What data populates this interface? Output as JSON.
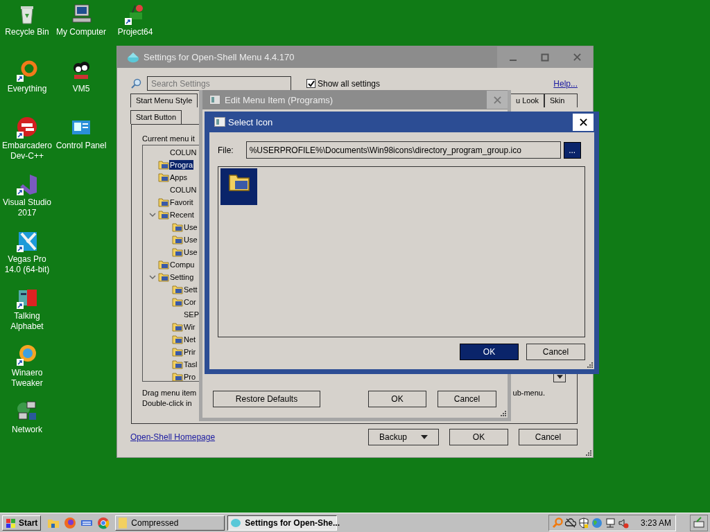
{
  "desktop_icons": [
    {
      "label": "Recycle Bin",
      "shortcut": false
    },
    {
      "label": "My Computer",
      "shortcut": false
    },
    {
      "label": "Project64",
      "shortcut": true
    },
    {
      "label": "Everything",
      "shortcut": true
    },
    {
      "label": "VM5",
      "shortcut": false
    },
    {
      "label": "Embarcadero Dev-C++",
      "shortcut": true
    },
    {
      "label": "Control Panel",
      "shortcut": false
    },
    {
      "label": "Visual Studio 2017",
      "shortcut": true
    },
    {
      "label": "Vegas Pro 14.0 (64-bit)",
      "shortcut": true
    },
    {
      "label": "Talking Alphabet",
      "shortcut": true
    },
    {
      "label": "Winaero Tweaker",
      "shortcut": true
    },
    {
      "label": "Network",
      "shortcut": false
    }
  ],
  "settings_window": {
    "title": "Settings for Open-Shell Menu 4.4.170",
    "search": {
      "placeholder": "Search Settings"
    },
    "show_all": {
      "label": "Show all settings",
      "checked": true
    },
    "help_link": "Help...",
    "tabs_row_1": [
      {
        "label": "Start Menu Style",
        "selected": false
      },
      {
        "label": "u Look",
        "selected": false
      },
      {
        "label": "Skin",
        "selected": false
      }
    ],
    "tabs_row_2": [
      {
        "label": "Start Button",
        "selected": false
      }
    ],
    "tree_label": "Current menu it",
    "tree": [
      {
        "label": "COLUN",
        "kind": "break",
        "selected": false
      },
      {
        "label": "Progra",
        "kind": "item",
        "selected": true
      },
      {
        "label": "Apps",
        "kind": "item",
        "selected": false
      },
      {
        "label": "COLUN",
        "kind": "break",
        "selected": false
      },
      {
        "label": "Favorit",
        "kind": "item",
        "selected": false
      },
      {
        "label": "Recent",
        "kind": "item",
        "selected": false,
        "expanded": true,
        "children": [
          {
            "label": "Use",
            "kind": "item",
            "selected": false
          },
          {
            "label": "Use",
            "kind": "item",
            "selected": false
          },
          {
            "label": "Use",
            "kind": "item",
            "selected": false
          }
        ]
      },
      {
        "label": "Compu",
        "kind": "item",
        "selected": false
      },
      {
        "label": "Setting",
        "kind": "item",
        "selected": false,
        "expanded": true,
        "children": [
          {
            "label": "Sett",
            "kind": "item",
            "selected": false
          },
          {
            "label": "Cor",
            "kind": "item",
            "selected": false
          },
          {
            "label": "SEP",
            "kind": "break",
            "selected": false
          },
          {
            "label": "Wir",
            "kind": "item",
            "selected": false
          },
          {
            "label": "Net",
            "kind": "item",
            "selected": false
          },
          {
            "label": "Prir",
            "kind": "item",
            "selected": false
          },
          {
            "label": "Tasl",
            "kind": "item",
            "selected": false
          },
          {
            "label": "Pro",
            "kind": "item",
            "selected": false
          }
        ]
      }
    ],
    "hint_lines": [
      "Drag menu item",
      "Double-click in"
    ],
    "hint_tail": "ub-menu.",
    "homepage_link": "Open-Shell Homepage",
    "buttons": [
      {
        "label": "Backup",
        "kind": "split"
      },
      {
        "label": "OK",
        "kind": "plain"
      },
      {
        "label": "Cancel",
        "kind": "plain"
      }
    ]
  },
  "edit_dialog": {
    "title": "Edit Menu Item (Programs)",
    "buttons": [
      "Restore Defaults",
      "OK",
      "Cancel"
    ]
  },
  "select_icon_dialog": {
    "title": "Select Icon",
    "file_label": "File:",
    "file_value": "%USERPROFILE%\\Documents\\Win98icons\\directory_program_group.ico",
    "browse_button": {
      "label": "...",
      "focused": true
    },
    "icons": [
      {
        "selected": true
      }
    ],
    "buttons": [
      {
        "label": "OK",
        "focused": true
      },
      {
        "label": "Cancel",
        "focused": false
      }
    ]
  },
  "taskbar": {
    "start": "Start",
    "tasks": [
      {
        "label": "Compressed",
        "selected": false
      },
      {
        "label": "Settings for Open-She...",
        "selected": true
      }
    ],
    "clock": "3:23 AM"
  }
}
